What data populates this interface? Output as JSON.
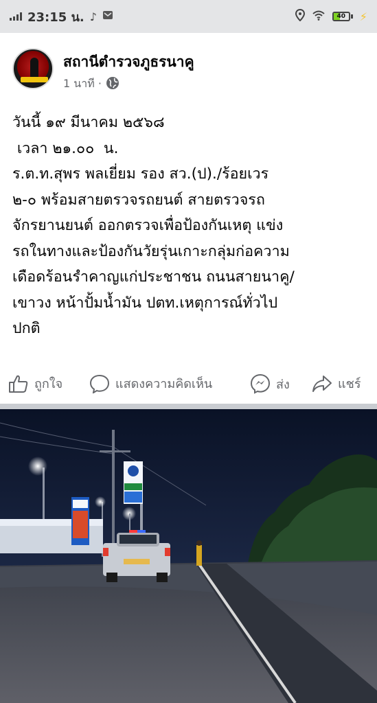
{
  "status_bar": {
    "time": "23:15 น.",
    "battery_level": "40",
    "battery_percent": 40,
    "icons": [
      "signal-icon",
      "tiktok-icon",
      "message-icon",
      "location-icon",
      "wifi-icon",
      "battery-icon",
      "charging-icon"
    ]
  },
  "post": {
    "page_name": "สถานีตำรวจภูธรนาคู",
    "time_ago": "1 นาที ·",
    "privacy_icon": "globe-icon",
    "body_lines": [
      "วันนี้ ๑๙ มีนาคม ๒๕๖๘",
      " เวลา ๒๑.๐๐  น.",
      "ร.ต.ท.สุพร พลเยี่ยม รอง สว.(ป)./ร้อยเวร",
      "๒-๐ พร้อมสายตรวจรถยนต์ สายตรวจรถ",
      "จักรยานยนต์ ออกตรวจเพื่อป้องกันเหตุ แข่ง",
      "รถในทางและป้องกันวัยรุ่นเกาะกลุ่มก่อความ",
      "เดือดร้อนรำคาญแก่ประชาชน ถนนสายนาคู/",
      "เขาวง หน้าปั้มน้ำมัน ปตท.เหตุการณ์ทั่วไป",
      "ปกติ"
    ]
  },
  "actions": {
    "like": "ถูกใจ",
    "comment": "แสดงความคิดเห็น",
    "send": "ส่ง",
    "share": "แชร์"
  },
  "photo": {
    "description_icons": [
      "gas-station-sign",
      "pickup-truck",
      "street-light",
      "trees"
    ]
  },
  "colors": {
    "status_bg": "#e4e5e7",
    "text": "#050505",
    "muted": "#65676b",
    "divider": "#c9ccd1"
  }
}
